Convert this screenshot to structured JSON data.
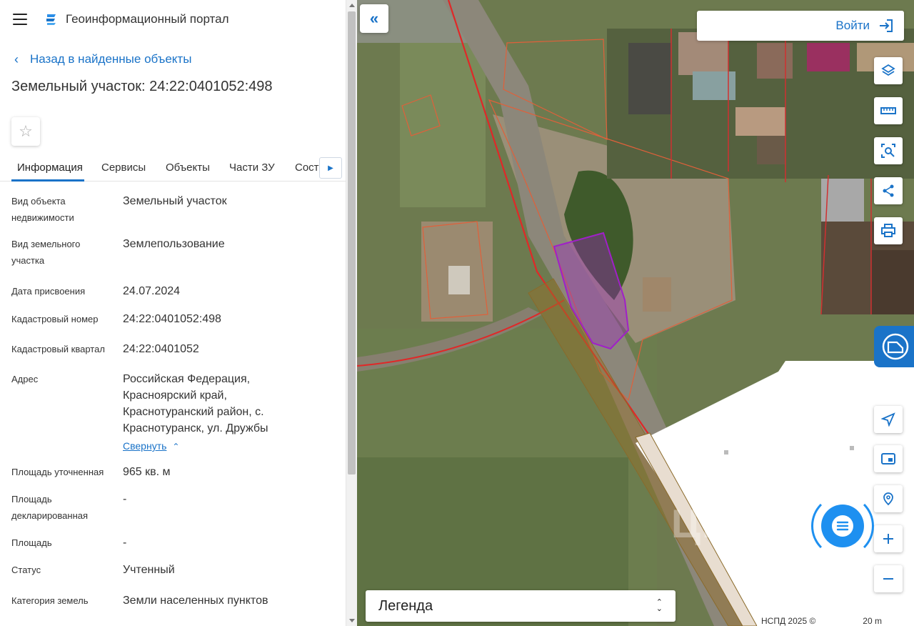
{
  "header": {
    "app_title": "Геоинформационный портал"
  },
  "nav": {
    "back_label": "Назад в найденные объекты"
  },
  "object": {
    "title": "Земельный участок: 24:22:0401052:498"
  },
  "tabs": [
    {
      "label": "Информация",
      "active": true
    },
    {
      "label": "Сервисы",
      "active": false
    },
    {
      "label": "Объекты",
      "active": false
    },
    {
      "label": "Части ЗУ",
      "active": false
    },
    {
      "label": "Соста...",
      "active": false
    }
  ],
  "properties": [
    {
      "label": "Вид объекта недвижимости",
      "value": "Земельный участок"
    },
    {
      "label": "Вид земельного участка",
      "value": "Землепользование"
    },
    {
      "label": "Дата присвоения",
      "value": "24.07.2024"
    },
    {
      "label": "Кадастровый номер",
      "value": "24:22:0401052:498"
    },
    {
      "label": "Кадастровый квартал",
      "value": "24:22:0401052"
    },
    {
      "label": "Адрес",
      "value": "Российская Федерация, Красноярский край, Краснотуранский район, с. Краснотуранск, ул. Дружбы"
    },
    {
      "label": "Площадь уточненная",
      "value": "965 кв. м"
    },
    {
      "label": "Площадь декларированная",
      "value": "-"
    },
    {
      "label": "Площадь",
      "value": "-"
    },
    {
      "label": "Статус",
      "value": "Учтенный"
    },
    {
      "label": "Категория земель",
      "value": "Земли населенных пунктов"
    }
  ],
  "address_collapse_label": "Свернуть",
  "map": {
    "login_label": "Войти",
    "legend_label": "Легенда",
    "copyright": "НСПД 2025 ©",
    "scale_label": "20 m",
    "watermark": "Циан",
    "colors": {
      "accent": "#1a73c8",
      "parcel_highlight": "#a020c8",
      "boundary_red": "#e02828",
      "boundary_orange": "#e0603a"
    },
    "controls": [
      "layers-icon",
      "ruler-icon",
      "search-area-icon",
      "share-icon",
      "print-icon",
      "locate-icon",
      "minimap-icon",
      "geo-search-icon",
      "zoom-in-icon",
      "zoom-out-icon"
    ]
  }
}
